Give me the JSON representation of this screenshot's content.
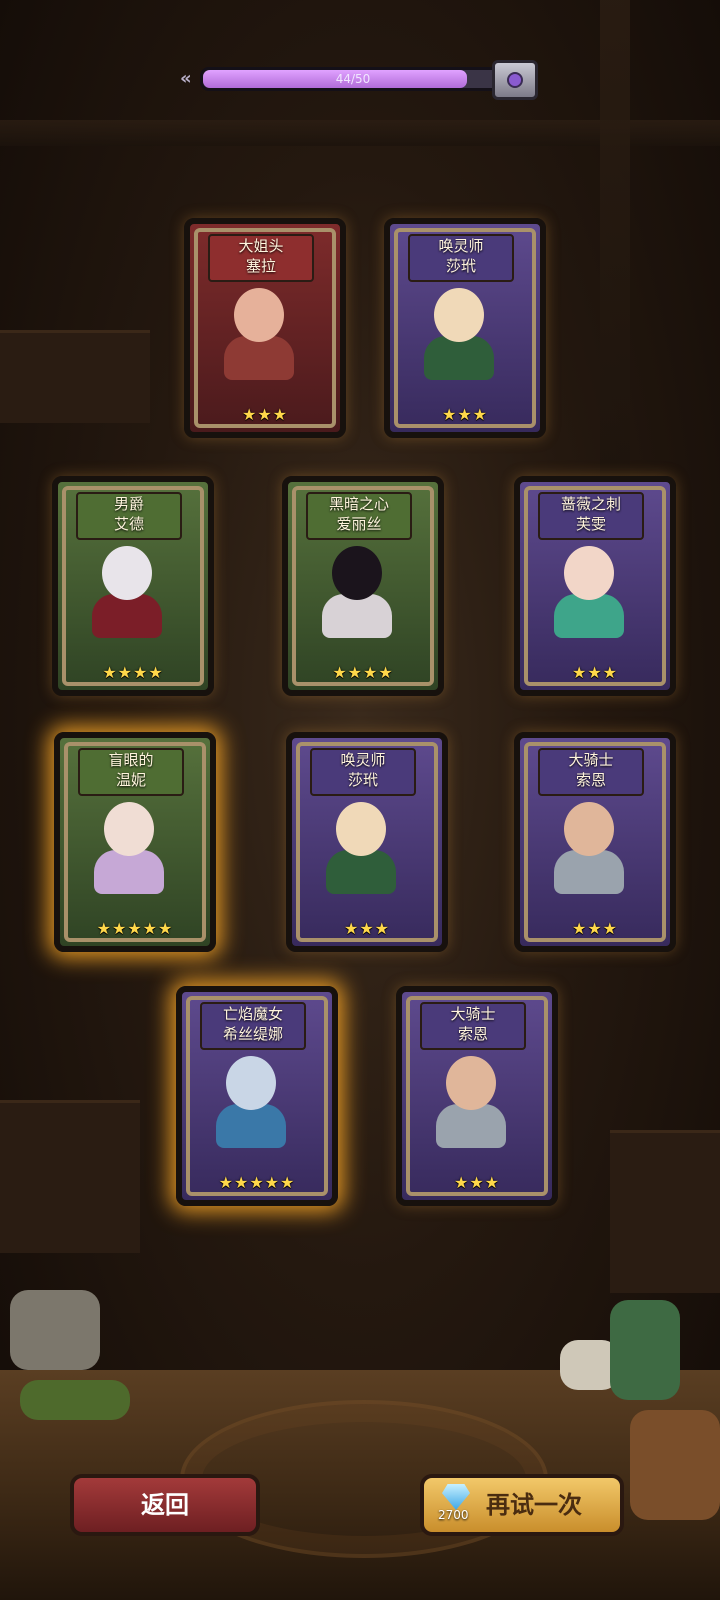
{
  "progress": {
    "text": "44/50",
    "value": 44,
    "max": 50
  },
  "cards": [
    {
      "title1": "大姐头",
      "title2": "塞拉",
      "stars": "★★★",
      "theme": "red",
      "highlight": false,
      "icon": "warrior-portrait"
    },
    {
      "title1": "唤灵师",
      "title2": "莎玳",
      "stars": "★★★",
      "theme": "purple",
      "highlight": false,
      "icon": "necromancer-portrait"
    },
    {
      "title1": "男爵",
      "title2": "艾德",
      "stars": "★★★★",
      "theme": "green",
      "highlight": false,
      "icon": "vampire-portrait"
    },
    {
      "title1": "黑暗之心",
      "title2": "爱丽丝",
      "stars": "★★★★",
      "theme": "green",
      "highlight": false,
      "icon": "dark-heart-portrait"
    },
    {
      "title1": "蔷薇之刺",
      "title2": "芙雯",
      "stars": "★★★",
      "theme": "purple",
      "highlight": false,
      "icon": "rose-thorn-portrait"
    },
    {
      "title1": "盲眼的",
      "title2": "温妮",
      "stars": "★★★★★",
      "theme": "green",
      "highlight": true,
      "icon": "blind-girl-portrait"
    },
    {
      "title1": "唤灵师",
      "title2": "莎玳",
      "stars": "★★★",
      "theme": "purple",
      "highlight": false,
      "icon": "necromancer-portrait"
    },
    {
      "title1": "大骑士",
      "title2": "索恩",
      "stars": "★★★",
      "theme": "purple",
      "highlight": false,
      "icon": "knight-portrait"
    },
    {
      "title1": "亡焰魔女",
      "title2": "希丝缇娜",
      "stars": "★★★★★",
      "theme": "purple",
      "highlight": true,
      "icon": "witch-portrait"
    },
    {
      "title1": "大骑士",
      "title2": "索恩",
      "stars": "★★★",
      "theme": "purple",
      "highlight": false,
      "icon": "knight-portrait"
    }
  ],
  "buttons": {
    "back": "返回",
    "retry": "再试一次",
    "retry_cost": "2700"
  },
  "colors": {
    "gold_glow": "#ffaa28",
    "star": "#ffd84a"
  }
}
